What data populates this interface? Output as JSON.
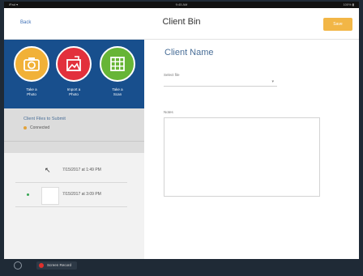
{
  "status_bar": {
    "left": "iPad ▾",
    "center": "9:45 AM",
    "right": "100% ▮"
  },
  "nav": {
    "back_label": "Back",
    "title": "Client Bin",
    "save_label": "Save"
  },
  "actions": [
    {
      "label": "Take a\nPhoto",
      "icon": "camera-icon",
      "color": "#f1b138"
    },
    {
      "label": "Import a\nPhoto",
      "icon": "image-import-icon",
      "color": "#e2303c"
    },
    {
      "label": "Take a\nScan",
      "icon": "grid-scan-icon",
      "color": "#67b536"
    }
  ],
  "sync": {
    "title": "Client Files to Submit",
    "status": "Connected",
    "status_color": "#e2a23a"
  },
  "history": [
    {
      "timestamp": "7/15/2017 at 1:49 PM"
    },
    {
      "timestamp": "7/15/2017 at 3:09 PM"
    }
  ],
  "detail": {
    "client_name": "Client Name",
    "select_label": "Select file",
    "select_value": "",
    "notes_label": "Notes",
    "notes_value": ""
  },
  "bottom": {
    "record_label": "Screen Record"
  }
}
